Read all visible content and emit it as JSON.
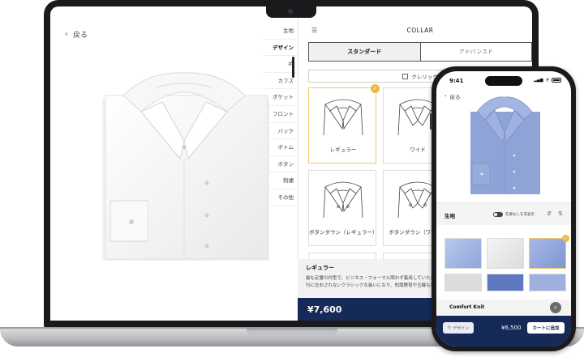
{
  "desktop": {
    "back_label": "戻る",
    "categories": [
      "生地",
      "デザイン",
      "衿",
      "カフス",
      "ポケット",
      "フロント",
      "バック",
      "ボトム",
      "ボタン",
      "刺繍",
      "その他"
    ],
    "panel_title": "COLLAR",
    "tabs": [
      "スタンダード",
      "アドバンスド"
    ],
    "clip_label": "クレリック",
    "collars": [
      "レギュラー",
      "ワイド",
      "ボタンダウン（レギュラー）",
      "ボタンダウン（ワイド）"
    ],
    "description": {
      "title": "レギュラー",
      "text_line1": "最も定番の衿型で、ビジネス・フォーマル問わず着用していただけ",
      "text_line2": "行に左右されないクラシックな装いになり、知識教育や玉鍵も可能"
    },
    "price": "¥7,600"
  },
  "mobile": {
    "time": "9:41",
    "back_label": "戻る",
    "fabric_label": "生地",
    "toggle_label": "在庫なしを非表示",
    "search_text": "Comfort Knit",
    "design_label": "デザイン",
    "price": "¥6,500",
    "cart_label": "カートに追加"
  },
  "colors": {
    "navy": "#152a57",
    "accent_gold": "#f0b840",
    "shirt_blue": "#8ea3d6"
  },
  "icons": [
    "chevron-left-icon",
    "list-icon",
    "check-icon",
    "search-icon",
    "sort-icon",
    "filter-icon",
    "refresh-icon"
  ]
}
